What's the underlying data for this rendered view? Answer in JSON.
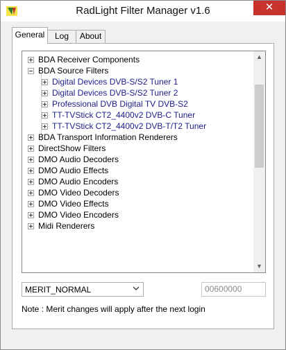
{
  "window": {
    "title": "RadLight Filter Manager v1.6",
    "close_label": "✕"
  },
  "tabs": [
    {
      "label": "General"
    },
    {
      "label": "Log"
    },
    {
      "label": "About"
    }
  ],
  "tree": {
    "items": [
      {
        "label": "BDA Receiver Components",
        "expand": "+"
      },
      {
        "label": "BDA Source Filters",
        "expand": "-"
      },
      {
        "label": "Digital Devices DVB-S/S2 Tuner 1",
        "expand": "+"
      },
      {
        "label": "Digital Devices DVB-S/S2 Tuner 2",
        "expand": "+"
      },
      {
        "label": "Professional DVB Digital TV DVB-S2",
        "expand": "+"
      },
      {
        "label": "TT-TVStick CT2_4400v2 DVB-C Tuner",
        "expand": "+"
      },
      {
        "label": "TT-TVStick CT2_4400v2 DVB-T/T2 Tuner",
        "expand": "+"
      },
      {
        "label": "BDA Transport Information Renderers",
        "expand": "+"
      },
      {
        "label": "DirectShow Filters",
        "expand": "+"
      },
      {
        "label": "DMO Audio Decoders",
        "expand": "+"
      },
      {
        "label": "DMO Audio Effects",
        "expand": "+"
      },
      {
        "label": "DMO Audio Encoders",
        "expand": "+"
      },
      {
        "label": "DMO Video Decoders",
        "expand": "+"
      },
      {
        "label": "DMO Video Effects",
        "expand": "+"
      },
      {
        "label": "DMO Video Encoders",
        "expand": "+"
      },
      {
        "label": "Midi Renderers",
        "expand": "+"
      }
    ]
  },
  "merit": {
    "selected": "MERIT_NORMAL",
    "value": "00600000"
  },
  "note": "Note : Merit changes will apply after the next login",
  "colors": {
    "close_bg": "#c7322d",
    "child_text": "#1c1c8c"
  }
}
